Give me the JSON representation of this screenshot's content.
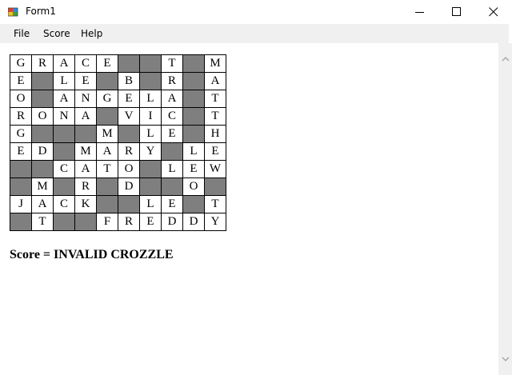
{
  "window": {
    "title": "Form1",
    "icon": "winforms-app-icon",
    "controls": [
      "minimize-icon",
      "maximize-icon",
      "close-icon"
    ]
  },
  "menu": {
    "items": [
      {
        "label": "File"
      },
      {
        "label": "Score"
      },
      {
        "label": "Help"
      }
    ]
  },
  "grid": {
    "rows": [
      "GRACE##T#M",
      "E#LE#B#R#A",
      "O#ANGELA#T",
      "RONA#VIC#T",
      "G###M#LE#H",
      "ED#MARY#LE",
      "##CATO#LEW",
      "#M#R#D##O#",
      "JACK##LE#T",
      "#T##FREDDY"
    ]
  },
  "score": {
    "text": "Score = INVALID CROZZLE"
  },
  "colors": {
    "blocked_cell": "#7f7f7f",
    "menu_background": "#f0f0f0"
  }
}
